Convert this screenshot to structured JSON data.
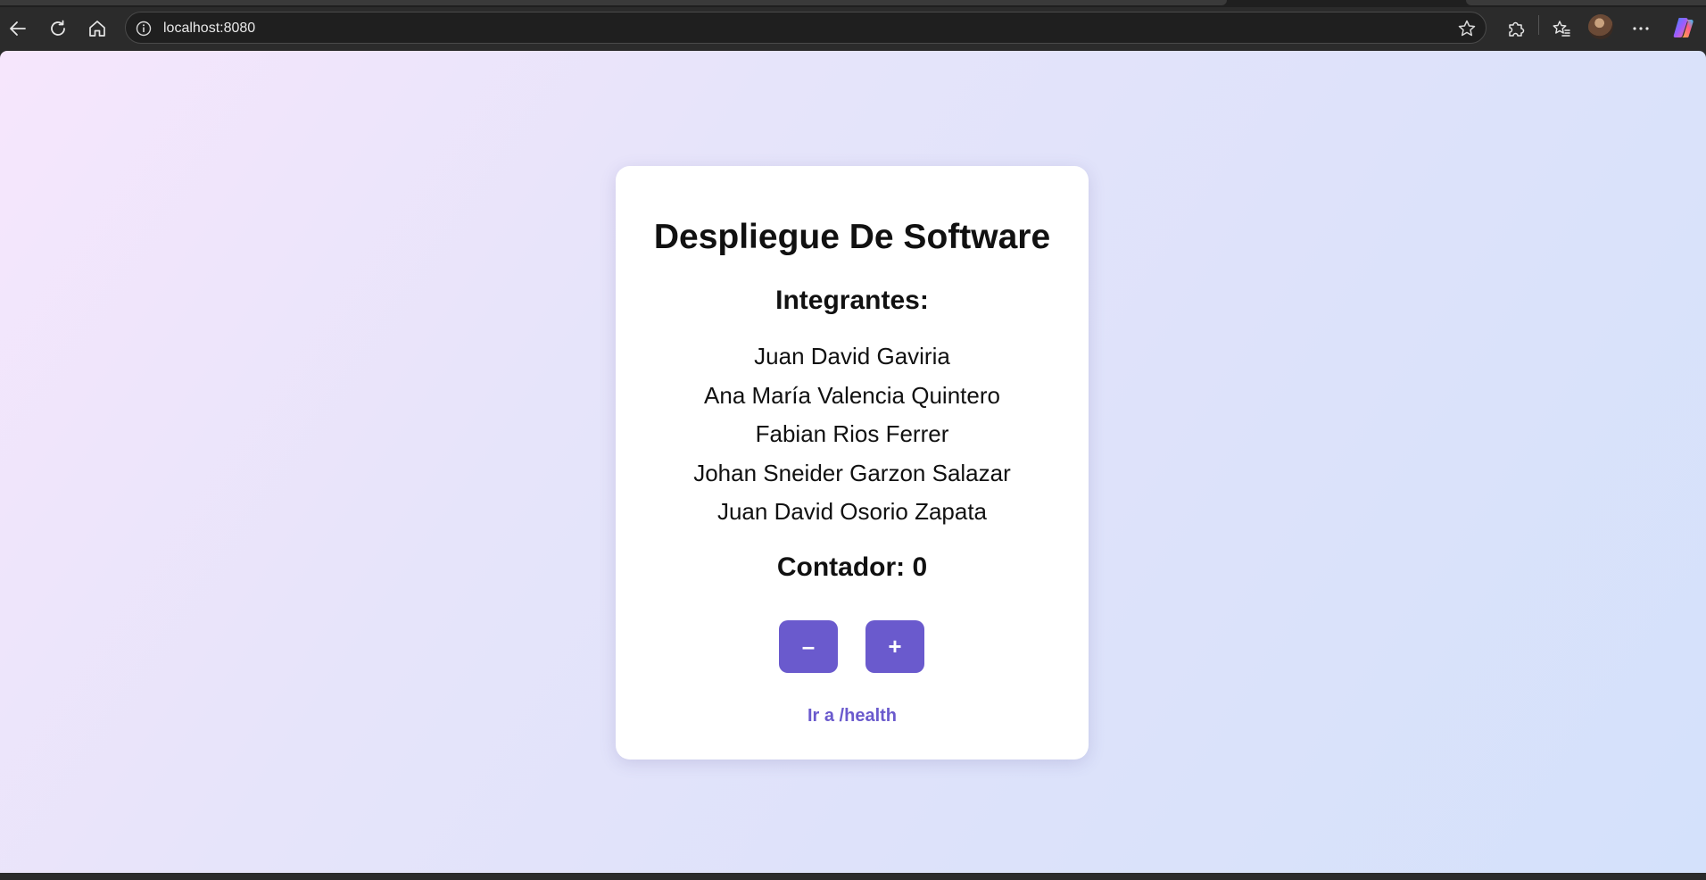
{
  "browser": {
    "url": "localhost:8080",
    "icons": {
      "back": "back-arrow-icon",
      "reload": "reload-icon",
      "home": "home-icon",
      "info": "info-icon",
      "favorite": "star-icon",
      "extensions": "puzzle-icon",
      "favorites": "favorites-list-icon",
      "profile": "avatar",
      "more": "more-dots-icon",
      "copilot": "copilot-icon"
    }
  },
  "page": {
    "title": "Despliegue De Software",
    "members_heading": "Integrantes:",
    "members": [
      "Juan David Gaviria",
      "Ana María Valencia Quintero",
      "Fabian Rios Ferrer",
      "Johan Sneider Garzon Salazar",
      "Juan David Osorio Zapata"
    ],
    "counter_label": "Contador: 0",
    "decrement_label": "–",
    "increment_label": "+",
    "health_link": "Ir a /health",
    "colors": {
      "accent": "#6a5acd",
      "card_bg": "#ffffff"
    }
  }
}
